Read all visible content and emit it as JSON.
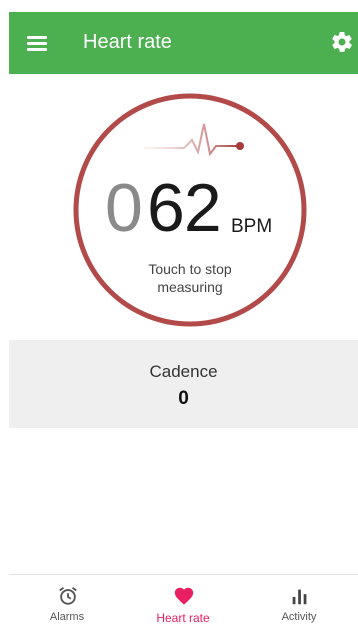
{
  "app_bar": {
    "title": "Heart rate",
    "background": "#4caf50",
    "menu_icon": "hamburger-menu-icon",
    "settings_icon": "gear-icon"
  },
  "measurement": {
    "leading_digit": "0",
    "value": "62",
    "unit": "BPM",
    "action_label_line1": "Touch to stop",
    "action_label_line2": "measuring",
    "ring_color": "#b24a4a",
    "pulse_icon": "heartbeat-line-icon"
  },
  "cadence": {
    "label": "Cadence",
    "value": "0"
  },
  "bottom_nav": {
    "active_color": "#e91e63",
    "items": [
      {
        "label": "Alarms",
        "icon": "alarm-clock-icon",
        "active": false
      },
      {
        "label": "Heart rate",
        "icon": "heart-icon",
        "active": true
      },
      {
        "label": "Activity",
        "icon": "bar-chart-icon",
        "active": false
      }
    ]
  }
}
